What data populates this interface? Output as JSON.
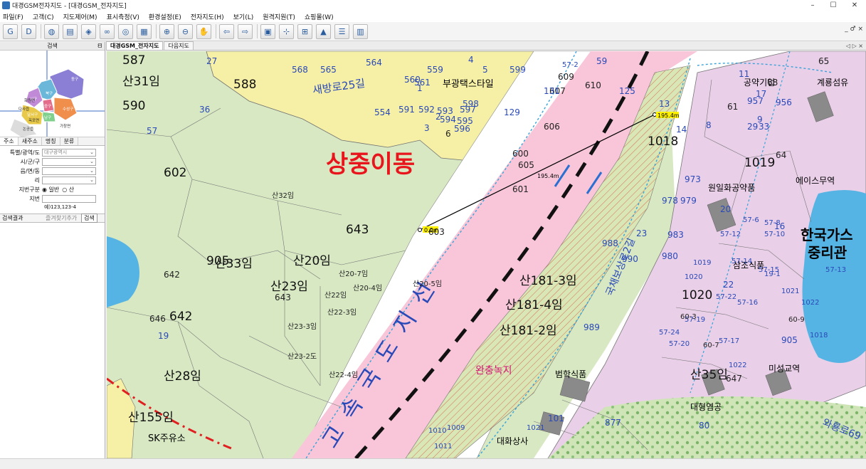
{
  "window": {
    "title": "대경GSM전자지도 - [대경GSM_전자지도]",
    "minimize": "–",
    "maximize": "☐",
    "close": "✕"
  },
  "menu": [
    "파일(F)",
    "고객(C)",
    "지도제어(M)",
    "표시측정(V)",
    "환경설정(E)",
    "전자지도(H)",
    "보기(L)",
    "원격지원(T)",
    "쇼핑몰(W)"
  ],
  "toolbar": {
    "buttons": [
      {
        "name": "gmap-button",
        "glyph": "G"
      },
      {
        "name": "d-button",
        "glyph": "D"
      },
      {
        "name": "globe-button",
        "glyph": "◍"
      },
      {
        "name": "print-button",
        "glyph": "▤"
      },
      {
        "name": "layer-button",
        "glyph": "◈"
      },
      {
        "name": "binocular-button",
        "glyph": "∞"
      },
      {
        "name": "view-button",
        "glyph": "◎"
      },
      {
        "name": "grid-button",
        "glyph": "▦"
      },
      {
        "name": "zoom-in-button",
        "glyph": "⊕"
      },
      {
        "name": "zoom-out-button",
        "glyph": "⊖"
      },
      {
        "name": "pan-button",
        "glyph": "✋"
      },
      {
        "name": "back-button",
        "glyph": "⇦"
      },
      {
        "name": "forward-button",
        "glyph": "⇨"
      },
      {
        "name": "info-button",
        "glyph": "▣"
      },
      {
        "name": "distance-button",
        "glyph": "⊹"
      },
      {
        "name": "area-button",
        "glyph": "⊞"
      },
      {
        "name": "marker-button",
        "glyph": "▲"
      },
      {
        "name": "list-button",
        "glyph": "☰"
      },
      {
        "name": "report-button",
        "glyph": "▥"
      }
    ]
  },
  "mdi_controls": "_ ♂ ×",
  "panel": {
    "title": "검색",
    "pin": "ᗺ",
    "tabs": [
      "주소",
      "새주소",
      "명칭",
      "분류"
    ],
    "fields": [
      {
        "label": "특별/광역/도",
        "value": "대구광역시"
      },
      {
        "label": "시/군/구",
        "value": ""
      },
      {
        "label": "읍/면/동",
        "value": ""
      },
      {
        "label": "리",
        "value": ""
      }
    ],
    "lot_type_label": "지번구분",
    "lot_type_general": "일반",
    "lot_type_mountain": "산",
    "lot_label": "지번",
    "lot_value": "",
    "lot_example": "예)123,123-4",
    "result_label": "검색결과",
    "favorite_add": "즐겨찾기추가",
    "search_button": "검색",
    "minimap_labels": [
      "북구",
      "동구",
      "서구",
      "중구",
      "수성구",
      "남구",
      "달서구",
      "화원면",
      "다사읍",
      "논공읍",
      "옥포면",
      "가창면"
    ]
  },
  "doc_tabs": [
    "대경GSM_전자지도",
    "다음지도"
  ],
  "tab_nav": "◁ ▷ ×",
  "map": {
    "district_name": "상중이동",
    "road_names": [
      "새방로25길",
      "국채보상로2길",
      "와룡로69"
    ],
    "railway_name": "고속국도지선",
    "green_zone": "완충녹지",
    "companies": [
      "부광택스타일",
      "공약기업",
      "계룡섬유",
      "원일화공약품",
      "에이스무역",
      "한국가스",
      "중리관",
      "삼조식품",
      "미성교역",
      "범학식품",
      "대형염공",
      "대화상사",
      "SK주유소"
    ],
    "measure": {
      "start": "0.0m",
      "end": "195.4m",
      "mid": "195.4m"
    },
    "lots_large": [
      "587",
      "588",
      "590",
      "602",
      "643",
      "642",
      "905",
      "1018",
      "1019",
      "1020",
      "산35임",
      "산33임",
      "산20임",
      "산23임",
      "산28임",
      "산31임",
      "산181-3임",
      "산181-4임",
      "산181-2임",
      "산155임"
    ],
    "lots_small": [
      "산32임",
      "산20-7임",
      "산20-4임",
      "산22임",
      "산22-3임",
      "산23-3임",
      "산23-2도",
      "산22-4임",
      "산20-5임",
      "596",
      "591",
      "592",
      "593",
      "594",
      "595",
      "597",
      "598",
      "599",
      "600",
      "601",
      "603",
      "605",
      "606",
      "607",
      "609",
      "610",
      "957",
      "956",
      "973",
      "978",
      "979",
      "983",
      "980",
      "988",
      "990",
      "989",
      "877",
      "1010",
      "1009",
      "1011",
      "1021",
      "1022",
      "568",
      "565",
      "564",
      "560",
      "559",
      "554",
      "561",
      "1",
      "2",
      "3",
      "4",
      "5",
      "6",
      "8",
      "9",
      "11",
      "13",
      "14",
      "16",
      "17",
      "19",
      "20",
      "22",
      "23",
      "27",
      "29",
      "33",
      "36",
      "57",
      "59",
      "61",
      "64",
      "65",
      "68",
      "80",
      "101",
      "125",
      "129",
      "131",
      "57-2",
      "57-6",
      "57-8",
      "57-10",
      "57-12",
      "57-13",
      "57-14",
      "57-15",
      "57-16",
      "57-17",
      "57-19",
      "57-20",
      "57-22",
      "57-24",
      "60-3",
      "60-7",
      "60-9",
      "19-1",
      "1019",
      "1020",
      "1021",
      "1022",
      "1018",
      "905",
      "647",
      "646",
      "643",
      "642"
    ]
  },
  "colors": {
    "urban": "#f6f0a6",
    "green": "#d8e8c3",
    "road": "#ffffff",
    "railway": "#f8c6d8",
    "industry": "#e9cfe8",
    "buffer": "#d5e5b1",
    "water": "#56b4e4",
    "forest": "#bdd9a6",
    "measure": "#000000",
    "label_blue": "#2a49b8",
    "label_red": "#e8161c"
  }
}
